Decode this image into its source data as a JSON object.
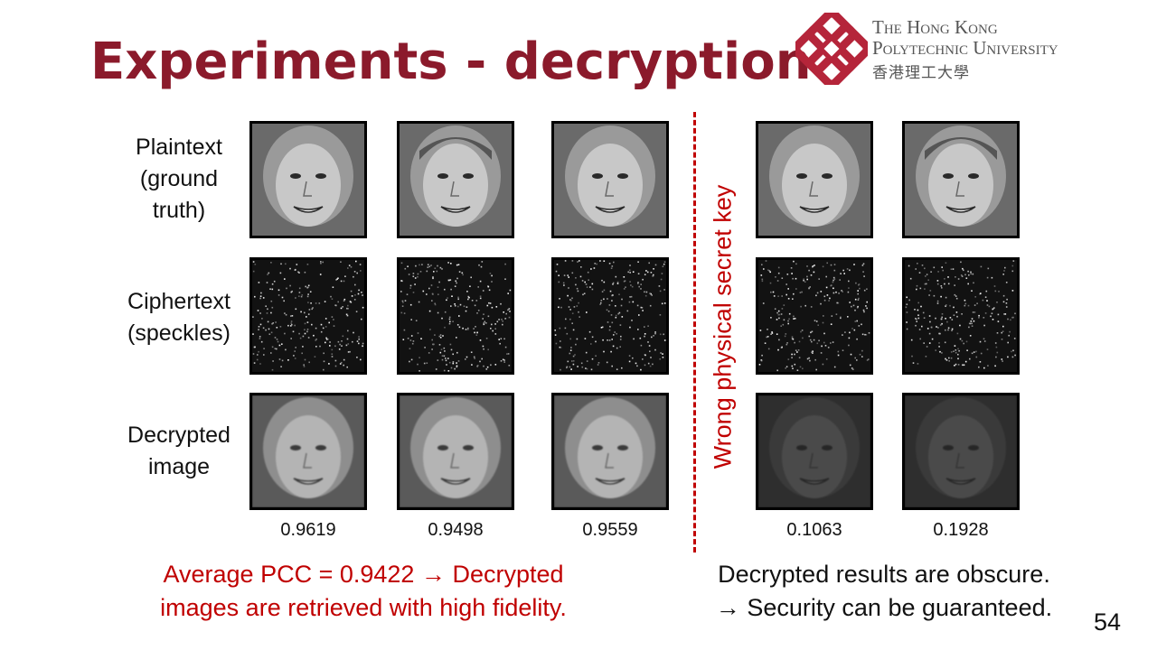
{
  "title": "Experiments - decryption",
  "logo": {
    "line1": "The Hong Kong",
    "line2": "Polytechnic University",
    "chinese": "香港理工大學"
  },
  "rows": {
    "plaintext": {
      "lines": [
        "Plaintext",
        "(ground",
        "truth)"
      ]
    },
    "ciphertext": {
      "lines": [
        "Ciphertext",
        "(speckles)"
      ]
    },
    "decrypted": {
      "lines": [
        "Decrypted",
        "image"
      ]
    }
  },
  "pcc_values": [
    "0.9619",
    "0.9498",
    "0.9559",
    "0.1063",
    "0.1928"
  ],
  "wrong_key_label": "Wrong physical secret key",
  "note_left": {
    "line1": "Average PCC = 0.9422 → Decrypted",
    "line2": "images are retrieved with high fidelity."
  },
  "note_right": {
    "line1": "Decrypted results are obscure.",
    "line2": "→ Security can be guaranteed."
  },
  "slide_number": "54",
  "colors": {
    "title": "#8b1a2b",
    "accent_red": "#c00000",
    "logo_red": "#b5253a"
  }
}
